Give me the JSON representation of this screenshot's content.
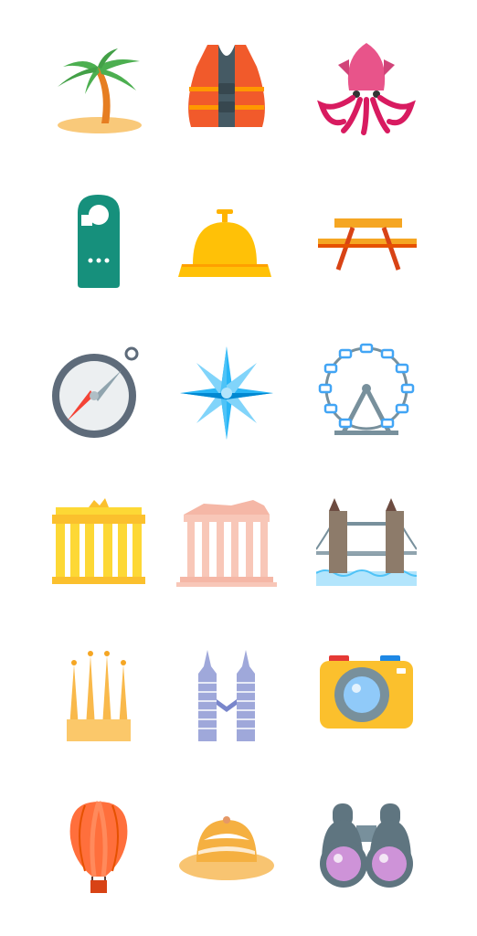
{
  "icons": [
    {
      "name": "palm-tree-icon"
    },
    {
      "name": "life-vest-icon"
    },
    {
      "name": "squid-icon"
    },
    {
      "name": "door-hanger-icon"
    },
    {
      "name": "service-bell-icon"
    },
    {
      "name": "picnic-table-icon"
    },
    {
      "name": "compass-icon"
    },
    {
      "name": "compass-rose-icon"
    },
    {
      "name": "ferris-wheel-icon"
    },
    {
      "name": "brandenburg-gate-icon"
    },
    {
      "name": "parthenon-icon"
    },
    {
      "name": "tower-bridge-icon"
    },
    {
      "name": "sagrada-familia-icon"
    },
    {
      "name": "petronas-towers-icon"
    },
    {
      "name": "camera-icon"
    },
    {
      "name": "hot-air-balloon-icon"
    },
    {
      "name": "pith-helmet-icon"
    },
    {
      "name": "binoculars-icon"
    }
  ],
  "colors": {
    "background": "#ffffff",
    "palm_leaves": "#4caf50",
    "palm_trunk": "#e67e22",
    "sand": "#f9c97a",
    "vest": "#f15a2b",
    "squid": "#e8548a",
    "hanger": "#16907c",
    "bell": "#ffc107",
    "table": "#f5a623",
    "compass_ring": "#5e6b7a",
    "star": "#4fc3f7",
    "wheel": "#78909c",
    "gate": "#fdd835",
    "parthenon": "#f8c7b8",
    "bridge": "#8d7b6a",
    "sagrada": "#f9b94b",
    "petronas": "#9fa8da",
    "camera": "#fbc02d",
    "balloon": "#ff6f3c",
    "helmet": "#f8c471",
    "binoculars": "#5f7580"
  }
}
